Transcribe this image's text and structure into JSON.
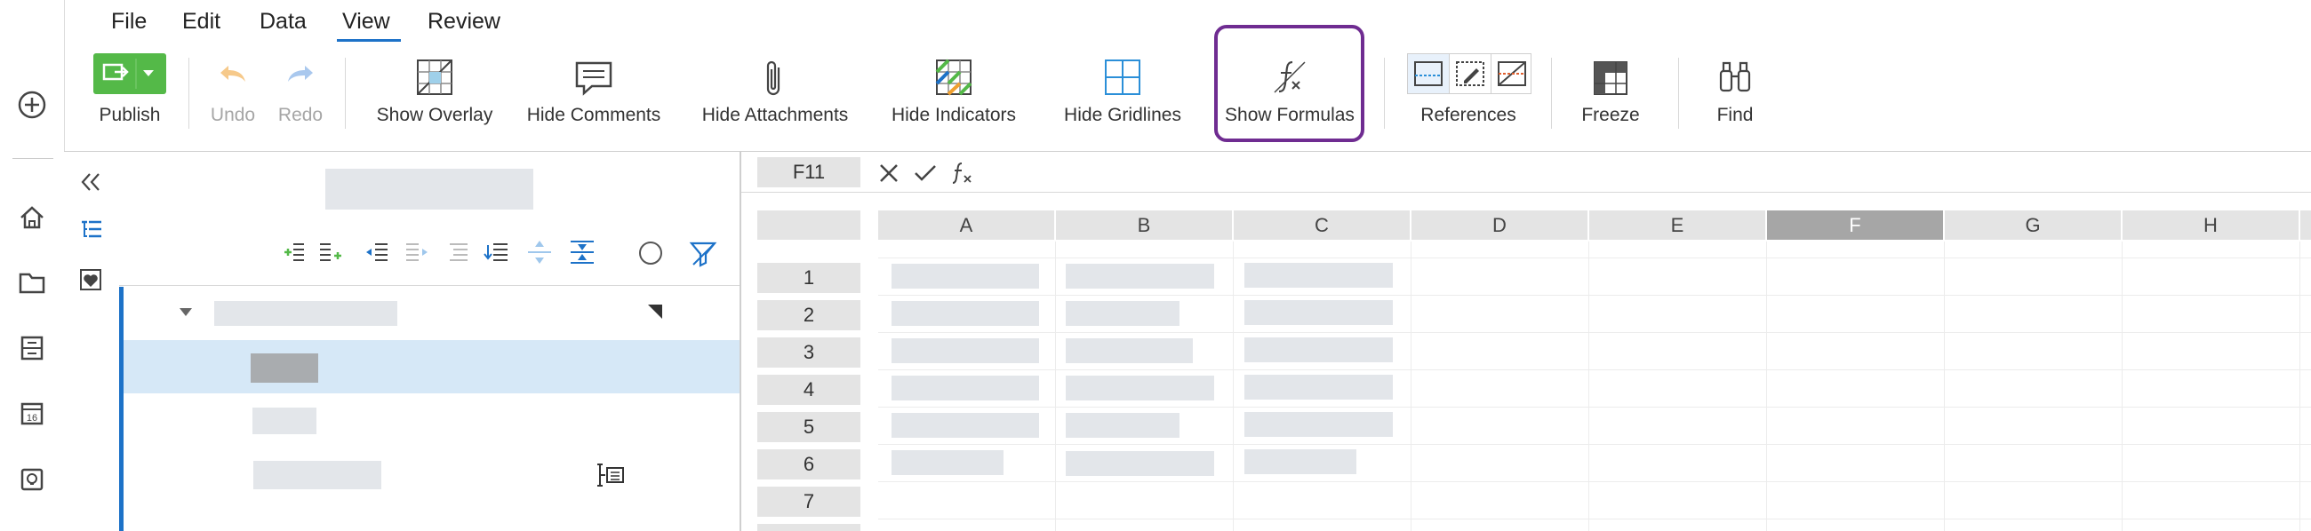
{
  "menu": {
    "items": [
      "File",
      "Edit",
      "Data",
      "View",
      "Review"
    ],
    "active": "View"
  },
  "ribbon": {
    "publish": "Publish",
    "undo": "Undo",
    "redo": "Redo",
    "show_overlay": "Show Overlay",
    "hide_comments": "Hide Comments",
    "hide_attachments": "Hide Attachments",
    "hide_indicators": "Hide Indicators",
    "hide_gridlines": "Hide Gridlines",
    "show_formulas": "Show Formulas",
    "references": "References",
    "freeze": "Freeze",
    "find": "Find"
  },
  "formula_bar": {
    "cell_ref": "F11",
    "fx": "fx"
  },
  "grid": {
    "columns": [
      "A",
      "B",
      "C",
      "D",
      "E",
      "F",
      "G",
      "H"
    ],
    "selected_column": "F",
    "rows": [
      "1",
      "2",
      "3",
      "4",
      "5",
      "6",
      "7"
    ]
  },
  "colors": {
    "publish_green": "#54b948",
    "highlight_border": "#6f2c91",
    "accent_blue": "#1d72c8",
    "selected_row": "#d6e8f7"
  }
}
